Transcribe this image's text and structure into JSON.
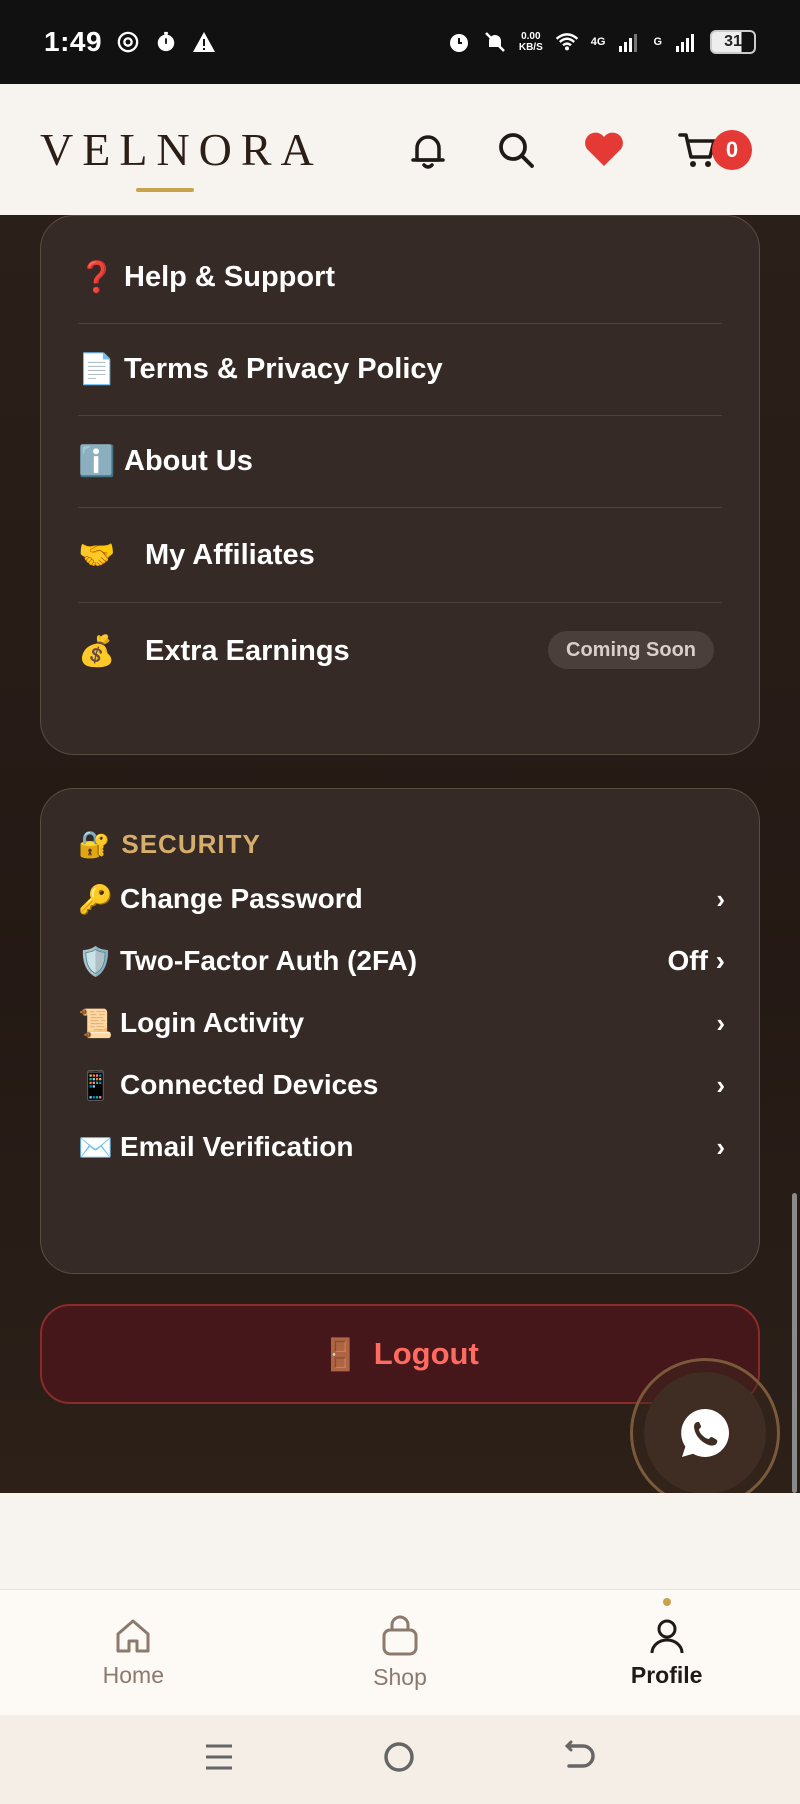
{
  "status_bar": {
    "time": "1:49",
    "speed_top": "0.00",
    "speed_bottom": "KB/S",
    "network_a": "4G",
    "network_b": "G",
    "battery": "31"
  },
  "header": {
    "logo": "VELNORA",
    "cart_count": "0"
  },
  "menu_card": {
    "items": [
      {
        "emoji": "❓",
        "label": "Help & Support"
      },
      {
        "emoji": "📄",
        "label": "Terms & Privacy Policy"
      },
      {
        "emoji": "ℹ️",
        "label": "About Us"
      },
      {
        "emoji": "🤝",
        "label": "My Affiliates"
      },
      {
        "emoji": "💰",
        "label": "Extra Earnings",
        "badge": "Coming Soon"
      }
    ]
  },
  "security": {
    "emoji": "🔐",
    "title": "SECURITY",
    "items": [
      {
        "emoji": "🔑",
        "label": "Change Password",
        "chevron": "›"
      },
      {
        "emoji": "🛡️",
        "label": "Two-Factor Auth (2FA)",
        "value": "Off ›"
      },
      {
        "emoji": "📜",
        "label": "Login Activity",
        "chevron": "›"
      },
      {
        "emoji": "📱",
        "label": "Connected Devices",
        "chevron": "›"
      },
      {
        "emoji": "✉️",
        "label": "Email Verification",
        "chevron": "›"
      }
    ]
  },
  "logout": {
    "emoji": "🚪",
    "label": "Logout"
  },
  "bottom_nav": {
    "items": [
      {
        "label": "Home"
      },
      {
        "label": "Shop"
      },
      {
        "label": "Profile"
      }
    ]
  },
  "colors": {
    "accent": "#c9a24e",
    "danger": "#e53935",
    "logout_text": "#ff6b5e",
    "card_bg": "#352a25"
  }
}
